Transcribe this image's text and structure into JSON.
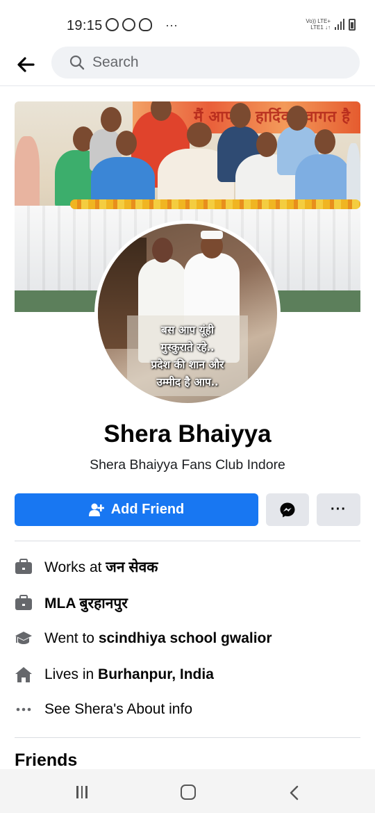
{
  "status_bar": {
    "time": "19:15",
    "notification_icons": [
      "notification-icon",
      "notification-icon",
      "notification-icon",
      "notification-icon"
    ],
    "more_dots": "···",
    "network_top": "Vo)) LTE+",
    "network_bottom": "LTE1 ↓↑"
  },
  "header": {
    "search_placeholder": "Search"
  },
  "cover": {
    "banner_text": "मैं आपका हार्दिक स्वागत है"
  },
  "profile": {
    "photo_quote_lines": [
      "बस आप यूंही",
      "मुस्कुराते रहे..",
      "प्रदेश की शान और",
      "उम्मीद है आप.."
    ],
    "name": "Shera Bhaiyya",
    "subtitle": "Shera Bhaiyya Fans Club Indore"
  },
  "actions": {
    "add_friend_label": "Add Friend",
    "more_label": "···"
  },
  "intro": {
    "works_prefix": "Works at ",
    "works_value": "जन सेवक",
    "position_value": "MLA बुरहानपुर",
    "education_prefix": "Went to ",
    "education_value": "scindhiya school gwalior",
    "lives_prefix": "Lives in ",
    "lives_value": "Burhanpur, India",
    "about_link": "See Shera's About info"
  },
  "friends": {
    "heading": "Friends"
  },
  "colors": {
    "primary": "#1877f2",
    "secondary_button": "#e4e6eb",
    "search_bg": "#f0f2f5"
  }
}
